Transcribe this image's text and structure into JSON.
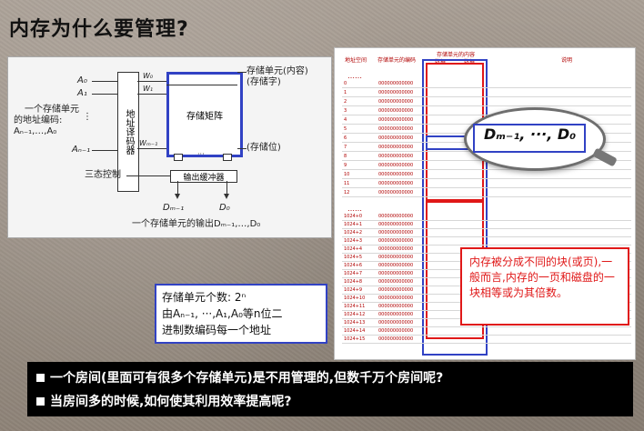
{
  "page": {
    "title": "内存为什么要管理?"
  },
  "diagram": {
    "left_label_lines": [
      "一个存储单元",
      "的地址编码:",
      "Aₙ₋₁,…,A₀"
    ],
    "inputs": [
      "A₀",
      "A₁",
      "⋮",
      "Aₙ₋₁"
    ],
    "decoder_label": "地址译码器",
    "word_lines": [
      "W₀",
      "W₁",
      "Wₘ₋₁"
    ],
    "matrix_label": "存储矩阵",
    "right_labels": [
      "存储单元(内容)",
      "(存储字)",
      "(存储位)"
    ],
    "tristate_label": "三态控制",
    "buffer_label": "输出缓冲器",
    "outputs": [
      "Dₘ₋₁",
      "D₀"
    ],
    "output_caption": "一个存储单元的输出Dₘ₋₁,…,D₀",
    "dots": "···"
  },
  "table": {
    "headers": [
      "地址空间",
      "存储单元的编码",
      "存储单元的内容",
      "说明"
    ],
    "sub_headers": [
      "数据",
      "数据"
    ],
    "rows_top": [
      "0",
      "1",
      "2",
      "3",
      "4",
      "5",
      "6",
      "7",
      "8",
      "9",
      "10",
      "11",
      "12"
    ],
    "rows_bottom": [
      "1024+0",
      "1024+1",
      "1024+2",
      "1024+3",
      "1024+4",
      "1024+5",
      "1024+6",
      "1024+7",
      "1024+8",
      "1024+9",
      "1024+10",
      "1024+11",
      "1024+12",
      "1024+13",
      "1024+14",
      "1024+15"
    ],
    "bin_prefix": "00000000",
    "dots": "……"
  },
  "magnifier": {
    "text": "Dₘ₋₁,   ···,   D₀"
  },
  "notes": {
    "right_box": "内存被分成不同的块(或页),一般而言,内存的一页和磁盘的一块相等或为其倍数。",
    "left_box_line1": "存储单元个数: 2ⁿ",
    "left_box_line2": "由Aₙ₋₁, ···,A₁,A₀等n位二",
    "left_box_line3": "进制数编码每一个地址"
  },
  "bottom_bar": {
    "line1": "一个房间(里面可有很多个存储单元)是不用管理的,但数千万个房间呢?",
    "line2": "当房间多的时候,如何使其利用效率提高呢?"
  },
  "colors": {
    "blue": "#3142c4",
    "red": "#e01818"
  }
}
